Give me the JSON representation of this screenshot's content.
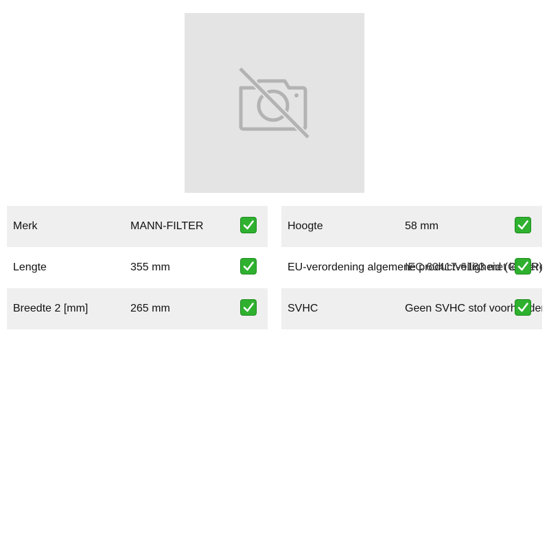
{
  "product_image": {
    "icon": "camera-off-icon",
    "background": "#e4e4e4"
  },
  "specs_left": [
    {
      "label": "Merk",
      "value": "MANN-FILTER",
      "status_icon": "check-icon"
    },
    {
      "label": "Lengte",
      "value": "355 mm",
      "status_icon": "check-icon"
    },
    {
      "label": "Breedte 2 [mm]",
      "value": "265 mm",
      "status_icon": "check-icon"
    }
  ],
  "specs_right": [
    {
      "label": "Hoogte",
      "value": "58 mm",
      "status_icon": "check-icon"
    },
    {
      "label": "EU-verordening algemene productveiligheid (GPSR)",
      "value": "IEC 60417-6183 met kinderen",
      "status_icon": "check-icon"
    },
    {
      "label": "SVHC",
      "value": "Geen SVHC stof voorhanden",
      "status_icon": "check-icon"
    }
  ],
  "colors": {
    "row_shade": "#efefef",
    "check": "#2fb12f"
  }
}
